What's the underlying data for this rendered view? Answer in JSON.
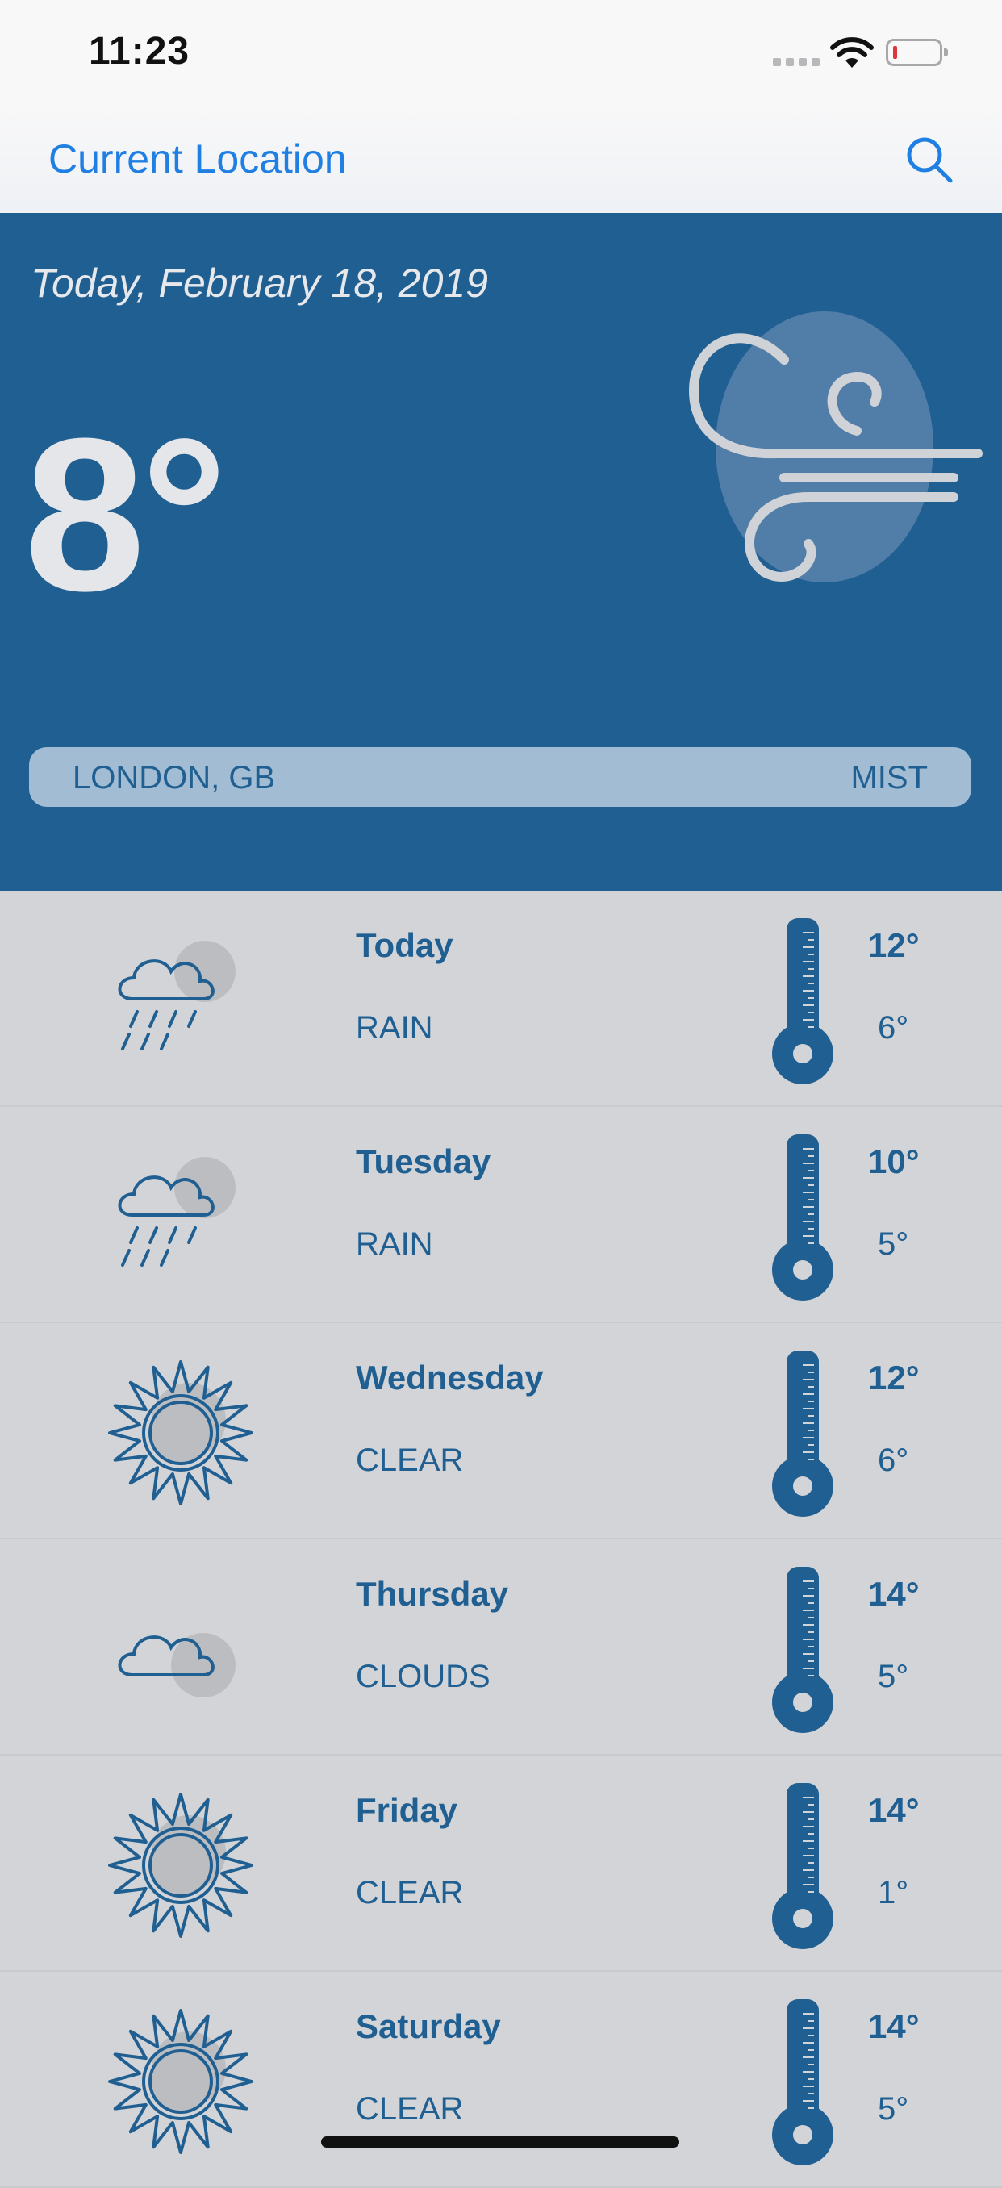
{
  "status_bar": {
    "time": "11:23"
  },
  "nav": {
    "title": "Current Location",
    "search_icon": "search-icon"
  },
  "current": {
    "date": "Today, February 18, 2019",
    "temperature": "8°",
    "location": "LONDON, GB",
    "condition": "MIST",
    "icon": "wind-icon"
  },
  "colors": {
    "accent": "#205f92",
    "link": "#1f7fe3",
    "list_bg": "#d3d4d7",
    "location_bar": "#a1bcd3"
  },
  "forecast": [
    {
      "day": "Today",
      "condition": "RAIN",
      "high": "12°",
      "low": "6°",
      "icon": "rain-icon"
    },
    {
      "day": "Tuesday",
      "condition": "RAIN",
      "high": "10°",
      "low": "5°",
      "icon": "rain-icon"
    },
    {
      "day": "Wednesday",
      "condition": "CLEAR",
      "high": "12°",
      "low": "6°",
      "icon": "sun-icon"
    },
    {
      "day": "Thursday",
      "condition": "CLOUDS",
      "high": "14°",
      "low": "5°",
      "icon": "cloud-icon"
    },
    {
      "day": "Friday",
      "condition": "CLEAR",
      "high": "14°",
      "low": "1°",
      "icon": "sun-icon"
    },
    {
      "day": "Saturday",
      "condition": "CLEAR",
      "high": "14°",
      "low": "5°",
      "icon": "sun-icon"
    }
  ]
}
